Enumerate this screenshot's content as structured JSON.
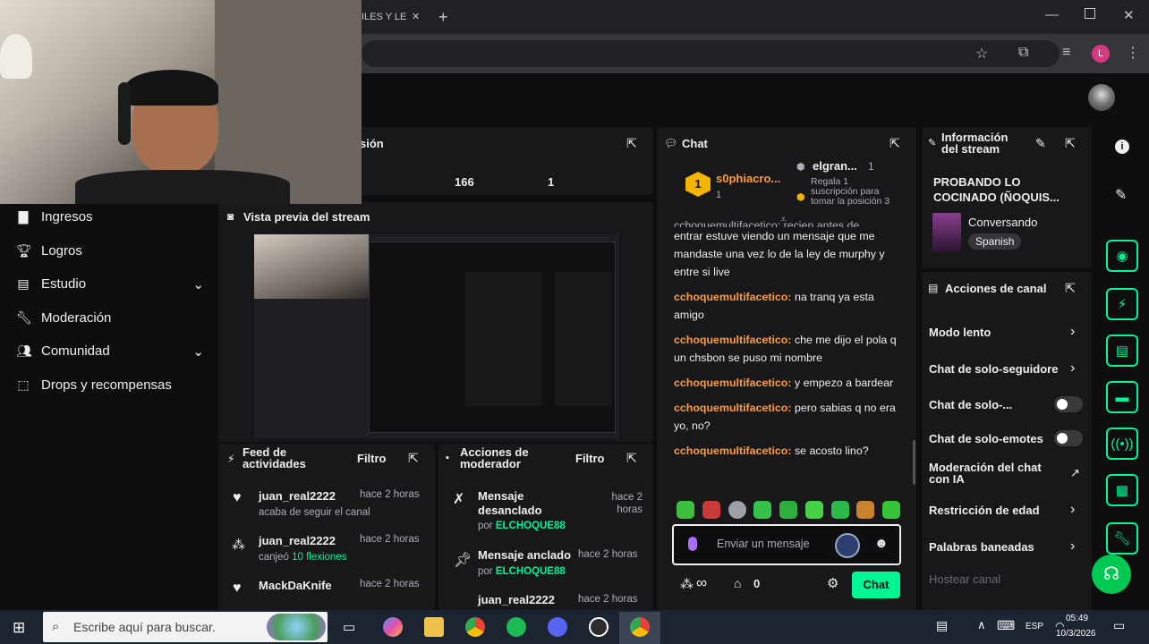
{
  "browser": {
    "tab_title_fragment": "ILES Y LE",
    "window_controls": [
      "minimize",
      "restore",
      "close"
    ],
    "profile_initial": "L"
  },
  "webcam": {
    "description_icon": "person-on-camera"
  },
  "stats_panel": {
    "title_fragment": "sión",
    "values": [
      "166",
      "1"
    ]
  },
  "sidebar": {
    "items": [
      {
        "label": "Ingresos",
        "icon": "bar-chart-icon",
        "expand": false
      },
      {
        "label": "Logros",
        "icon": "trophy-icon",
        "expand": false
      },
      {
        "label": "Estudio",
        "icon": "studio-icon",
        "expand": true
      },
      {
        "label": "Moderación",
        "icon": "wrench-icon",
        "expand": false
      },
      {
        "label": "Comunidad",
        "icon": "community-icon",
        "expand": true
      },
      {
        "label": "Drops y recompensas",
        "icon": "drops-icon",
        "expand": false
      }
    ]
  },
  "preview": {
    "title": "Vista previa del stream"
  },
  "feed": {
    "title": "Feed de actividades",
    "filter": "Filtro",
    "items": [
      {
        "user": "juan_real2222",
        "time": "hace 2 horas",
        "desc": "acaba de seguir el canal",
        "desc_highlight": ""
      },
      {
        "user": "juan_real2222",
        "time": "hace 2 horas",
        "desc": "canjeó ",
        "desc_highlight": "10 flexiones"
      },
      {
        "user": "MackDaKnife",
        "time": "hace 2 horas",
        "desc": "",
        "desc_highlight": ""
      }
    ]
  },
  "mod_actions": {
    "title": "Acciones de moderador",
    "filter": "Filtro",
    "items": [
      {
        "action": "Mensaje desanclado",
        "by": "por ",
        "by_user": "ELCHOQUE88",
        "time": "hace 2 horas"
      },
      {
        "action": "Mensaje anclado",
        "by": "por ",
        "by_user": "ELCHOQUE88",
        "time": "hace 2 horas"
      },
      {
        "action": "juan_real2222",
        "by": "",
        "by_user": "",
        "time": "hace 2 horas"
      }
    ]
  },
  "chat": {
    "title": "Chat",
    "leaderboard": {
      "rank": "1",
      "first_user": "s0phiacro...",
      "first_count": "1",
      "gift_user": "elgran...",
      "gift_count": "1",
      "gift_text": "Regala 1 suscripción para tomar la posición 3"
    },
    "messages": [
      {
        "user": "",
        "text": "entrar estuve viendo un mensaje que me mandaste una vez lo de la ley de murphy y entre si live"
      },
      {
        "user": "cchoquemultifacetico:",
        "text": " na tranq ya esta amigo"
      },
      {
        "user": "cchoquemultifacetico:",
        "text": " che me dijo el pola q un chsbon se puso mi nombre"
      },
      {
        "user": "cchoquemultifacetico:",
        "text": " y empezo a bardear"
      },
      {
        "user": "cchoquemultifacetico:",
        "text": " pero sabias q no era yo, no?"
      },
      {
        "user": "cchoquemultifacetico:",
        "text": " se acosto lino?"
      }
    ],
    "partial_top": "cchoquemultifacetico: recien antes de",
    "input_placeholder": "Enviar un mensaje",
    "points": "∞",
    "store_count": "0",
    "send_label": "Chat"
  },
  "stream_info": {
    "title": "Información del stream",
    "stream_title": "PROBANDO LO COCINADO (ÑOQUIS...",
    "category": "Conversando",
    "language": "Spanish"
  },
  "channel_actions": {
    "title": "Acciones de canal",
    "items": [
      {
        "label": "Modo lento",
        "control": "chevron"
      },
      {
        "label": "Chat de solo-seguidore",
        "control": "chevron"
      },
      {
        "label": "Chat de solo-...",
        "control": "toggle"
      },
      {
        "label": "Chat de solo-emotes",
        "control": "toggle"
      },
      {
        "label": "Moderación del chat con IA",
        "control": "external"
      },
      {
        "label": "Restricción de edad",
        "control": "chevron"
      },
      {
        "label": "Palabras baneadas",
        "control": "chevron"
      },
      {
        "label": "Hostear canal",
        "control": "none"
      }
    ]
  },
  "taskbar": {
    "search_placeholder": "Escribe aquí para buscar.",
    "lang": "ESP",
    "time": "05:49",
    "date": "10/3/2026"
  },
  "colors": {
    "accent": "#00f593",
    "user": "#ff9b3d",
    "panel": "#18181b",
    "bg": "#0e0e10"
  }
}
